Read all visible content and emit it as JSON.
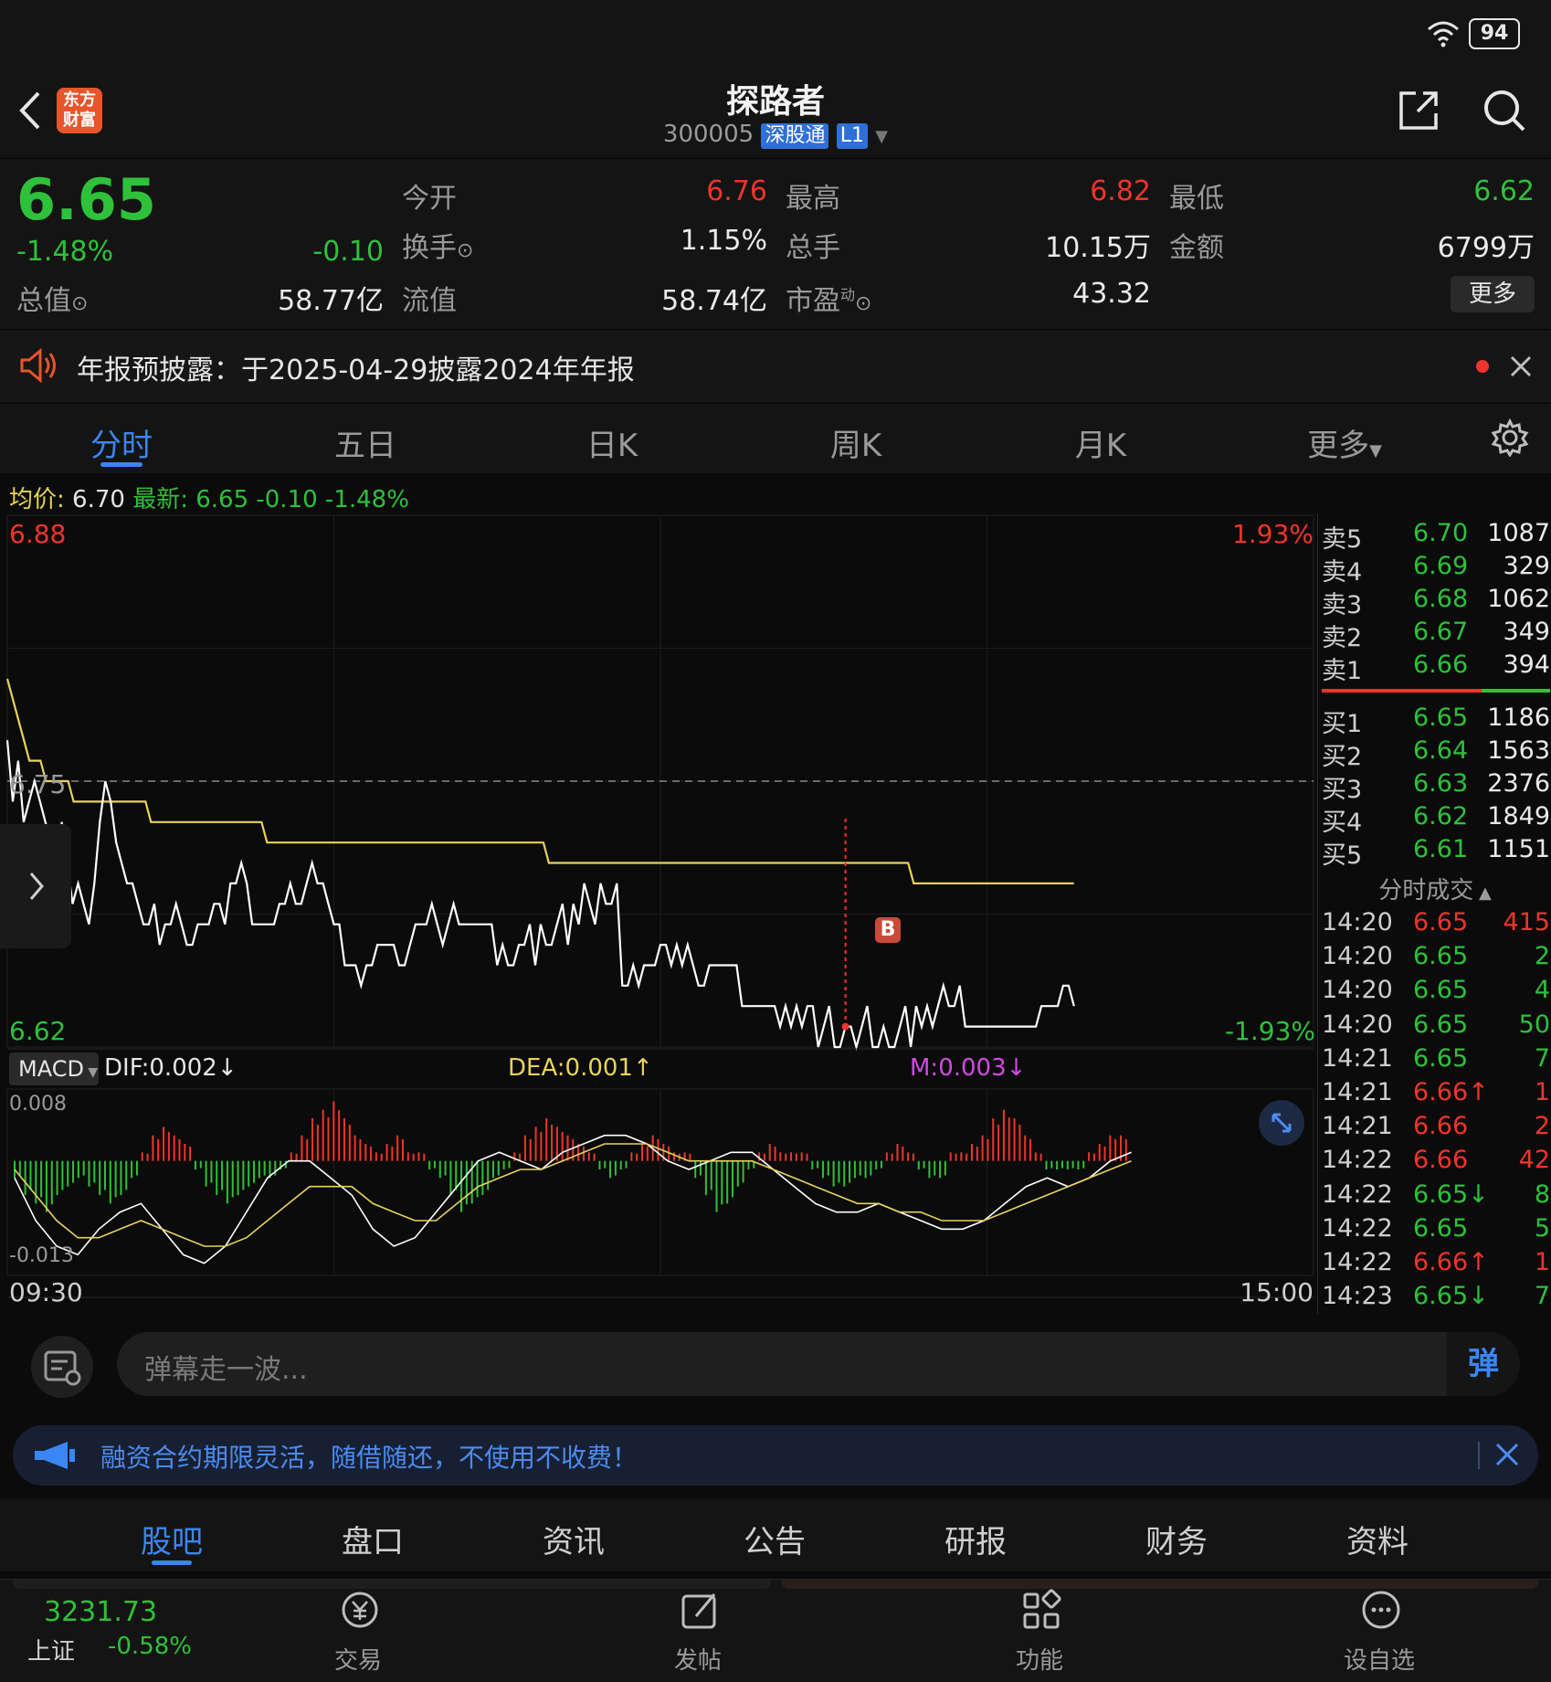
{
  "status": {
    "battery": "94"
  },
  "header": {
    "app_logo_text": "东方财富",
    "title": "探路者",
    "code": "300005",
    "tag1": "深股通",
    "tag2": "L1"
  },
  "quote": {
    "price": "6.65",
    "change_pct": "-1.48%",
    "change": "-0.10",
    "total_value_label": "总值",
    "total_value": "58.77亿",
    "open_label": "今开",
    "open": "6.76",
    "high_label": "最高",
    "high": "6.82",
    "low_label": "最低",
    "low": "6.62",
    "turnover_label": "换手",
    "turnover": "1.15%",
    "volume_label": "总手",
    "volume": "10.15万",
    "amount_label": "金额",
    "amount": "6799万",
    "float_label": "流值",
    "float_value": "58.74亿",
    "pe_label": "市盈",
    "pe_sup": "动",
    "pe": "43.32",
    "more_button": "更多"
  },
  "notice": {
    "text": "年报预披露：于2025-04-29披露2024年年报"
  },
  "ktabs": [
    "分时",
    "五日",
    "日K",
    "周K",
    "月K",
    "更多"
  ],
  "ktabs_active": 0,
  "chart_header": {
    "avg_label": "均价:",
    "avg": "6.70",
    "latest_label": "最新:",
    "latest": "6.65",
    "latest_change": "-0.10",
    "latest_pct": "-1.48%"
  },
  "chart_data": {
    "type": "line",
    "y_max_label": "6.88",
    "y_mid_label": "6.75",
    "y_min_label": "6.62",
    "pct_max_label": "1.93%",
    "pct_min_label": "-1.93%",
    "ylim": [
      6.62,
      6.88
    ],
    "prev_close": 6.75,
    "x_start_label": "09:30",
    "x_end_label": "15:00",
    "session_minutes": 240,
    "series": [
      {
        "values": [
          6.77,
          6.74,
          6.76,
          6.73,
          6.74,
          6.75,
          6.74,
          6.73,
          6.72,
          6.71,
          6.73,
          6.71,
          6.69,
          6.7,
          6.69,
          6.68,
          6.7,
          6.73,
          6.75,
          6.74,
          6.72,
          6.71,
          6.7,
          6.7,
          6.69,
          6.68,
          6.68,
          6.69,
          6.67,
          6.68,
          6.68,
          6.69,
          6.68,
          6.67,
          6.67,
          6.68,
          6.68,
          6.68,
          6.69,
          6.69,
          6.68,
          6.7,
          6.7,
          6.71,
          6.7,
          6.68,
          6.68,
          6.68,
          6.68,
          6.68,
          6.69,
          6.69,
          6.7,
          6.69,
          6.69,
          6.7,
          6.71,
          6.7,
          6.7,
          6.69,
          6.68,
          6.68,
          6.66,
          6.66,
          6.66,
          6.65,
          6.66,
          6.66,
          6.67,
          6.67,
          6.67,
          6.67,
          6.66,
          6.66,
          6.67,
          6.68,
          6.68,
          6.68,
          6.69,
          6.68,
          6.67,
          6.68,
          6.69,
          6.68,
          6.68,
          6.68,
          6.68,
          6.68,
          6.68,
          6.68,
          6.66,
          6.67,
          6.66,
          6.66,
          6.67,
          6.67,
          6.68,
          6.66,
          6.68,
          6.67,
          6.67,
          6.68,
          6.69,
          6.67,
          6.69,
          6.68,
          6.7,
          6.69,
          6.68,
          6.7,
          6.69,
          6.69,
          6.7,
          6.65,
          6.65,
          6.66,
          6.65,
          6.66,
          6.66,
          6.66,
          6.67,
          6.67,
          6.66,
          6.67,
          6.66,
          6.67,
          6.66,
          6.65,
          6.65,
          6.66,
          6.66,
          6.66,
          6.66,
          6.66,
          6.66,
          6.64,
          6.64,
          6.64,
          6.64,
          6.64,
          6.64,
          6.64,
          6.63,
          6.64,
          6.63,
          6.64,
          6.63,
          6.64,
          6.64,
          6.62,
          6.63,
          6.64,
          6.62,
          6.62,
          6.63,
          6.63,
          6.62,
          6.63,
          6.64,
          6.62,
          6.62,
          6.63,
          6.62,
          6.62,
          6.63,
          6.64,
          6.62,
          6.64,
          6.63,
          6.64,
          6.63,
          6.64,
          6.65,
          6.64,
          6.64,
          6.65,
          6.63,
          6.63,
          6.63,
          6.63,
          6.63,
          6.63,
          6.63,
          6.63,
          6.63,
          6.63,
          6.63,
          6.63,
          6.63,
          6.63,
          6.64,
          6.64,
          6.64,
          6.64,
          6.65,
          6.65,
          6.64
        ]
      },
      {
        "values": [
          6.8,
          6.79,
          6.78,
          6.77,
          6.76,
          6.76,
          6.76,
          6.75,
          6.75,
          6.75,
          6.75,
          6.75,
          6.74,
          6.74,
          6.74,
          6.74,
          6.74,
          6.74,
          6.74,
          6.74,
          6.74,
          6.74,
          6.74,
          6.74,
          6.74,
          6.74,
          6.73,
          6.73,
          6.73,
          6.73,
          6.73,
          6.73,
          6.73,
          6.73,
          6.73,
          6.73,
          6.73,
          6.73,
          6.73,
          6.73,
          6.73,
          6.73,
          6.73,
          6.73,
          6.73,
          6.73,
          6.73,
          6.72,
          6.72,
          6.72,
          6.72,
          6.72,
          6.72,
          6.72,
          6.72,
          6.72,
          6.72,
          6.72,
          6.72,
          6.72,
          6.72,
          6.72,
          6.72,
          6.72,
          6.72,
          6.72,
          6.72,
          6.72,
          6.72,
          6.72,
          6.72,
          6.72,
          6.72,
          6.72,
          6.72,
          6.72,
          6.72,
          6.72,
          6.72,
          6.72,
          6.72,
          6.72,
          6.72,
          6.72,
          6.72,
          6.72,
          6.72,
          6.72,
          6.72,
          6.72,
          6.72,
          6.72,
          6.72,
          6.72,
          6.72,
          6.72,
          6.72,
          6.72,
          6.71,
          6.71,
          6.71,
          6.71,
          6.71,
          6.71,
          6.71,
          6.71,
          6.71,
          6.71,
          6.71,
          6.71,
          6.71,
          6.71,
          6.71,
          6.71,
          6.71,
          6.71,
          6.71,
          6.71,
          6.71,
          6.71,
          6.71,
          6.71,
          6.71,
          6.71,
          6.71,
          6.71,
          6.71,
          6.71,
          6.71,
          6.71,
          6.71,
          6.71,
          6.71,
          6.71,
          6.71,
          6.71,
          6.71,
          6.71,
          6.71,
          6.71,
          6.71,
          6.71,
          6.71,
          6.71,
          6.71,
          6.71,
          6.71,
          6.71,
          6.71,
          6.71,
          6.71,
          6.71,
          6.71,
          6.71,
          6.71,
          6.71,
          6.71,
          6.71,
          6.71,
          6.71,
          6.71,
          6.71,
          6.71,
          6.71,
          6.7,
          6.7,
          6.7,
          6.7,
          6.7,
          6.7,
          6.7,
          6.7,
          6.7,
          6.7,
          6.7,
          6.7,
          6.7,
          6.7,
          6.7,
          6.7,
          6.7,
          6.7,
          6.7,
          6.7,
          6.7,
          6.7,
          6.7,
          6.7,
          6.7,
          6.7,
          6.7,
          6.7,
          6.7,
          6.7
        ]
      }
    ],
    "macd": {
      "label": "MACD",
      "dif": "DIF:0.002",
      "dea": "DEA:0.001",
      "m": "M:0.003",
      "top_label": "0.008",
      "bottom_label": "-0.013",
      "ylim": [
        -0.013,
        0.008
      ],
      "hist": [
        -0.002,
        -0.004,
        -0.005,
        -0.006,
        -0.004,
        -0.003,
        -0.002,
        -0.003,
        -0.004,
        -0.005,
        -0.004,
        -0.002,
        0.001,
        0.003,
        0.004,
        0.003,
        0.002,
        -0.001,
        -0.003,
        -0.004,
        -0.005,
        -0.004,
        -0.003,
        -0.002,
        -0.002,
        -0.001,
        0.001,
        0.003,
        0.005,
        0.006,
        0.007,
        0.005,
        0.003,
        0.002,
        0.001,
        0.002,
        0.003,
        0.001,
        0.001,
        -0.001,
        -0.002,
        -0.004,
        -0.006,
        -0.005,
        -0.004,
        -0.002,
        -0.001,
        0.001,
        0.003,
        0.004,
        0.005,
        0.004,
        0.003,
        0.002,
        0.001,
        -0.001,
        -0.002,
        -0.001,
        0.001,
        0.002,
        0.003,
        0.002,
        0.001,
        0.001,
        -0.002,
        -0.004,
        -0.006,
        -0.005,
        -0.003,
        -0.001,
        0.001,
        0.002,
        0.001,
        0.001,
        0.001,
        -0.001,
        -0.002,
        -0.003,
        -0.003,
        -0.002,
        -0.002,
        -0.001,
        0.001,
        0.002,
        0.001,
        -0.001,
        -0.002,
        -0.002,
        0.001,
        0.001,
        0.002,
        0.003,
        0.005,
        0.006,
        0.005,
        0.003,
        0.001,
        -0.001,
        -0.001,
        -0.001,
        -0.001,
        0.001,
        0.002,
        0.003,
        0.003
      ],
      "dif_line": [
        -0.002,
        -0.007,
        -0.01,
        -0.011,
        -0.008,
        -0.006,
        -0.005,
        -0.008,
        -0.011,
        -0.012,
        -0.01,
        -0.006,
        -0.002,
        0.0,
        0.0,
        -0.002,
        -0.004,
        -0.008,
        -0.01,
        -0.009,
        -0.006,
        -0.003,
        0.0,
        0.001,
        0.0,
        -0.001,
        0.001,
        0.002,
        0.003,
        0.003,
        0.002,
        0.0,
        -0.001,
        0.0,
        0.001,
        0.001,
        -0.001,
        -0.003,
        -0.005,
        -0.006,
        -0.006,
        -0.005,
        -0.006,
        -0.007,
        -0.008,
        -0.008,
        -0.007,
        -0.005,
        -0.003,
        -0.002,
        -0.003,
        -0.002,
        0.0,
        0.001
      ],
      "dea_line": [
        -0.001,
        -0.004,
        -0.007,
        -0.009,
        -0.009,
        -0.008,
        -0.007,
        -0.008,
        -0.009,
        -0.01,
        -0.01,
        -0.009,
        -0.007,
        -0.005,
        -0.003,
        -0.003,
        -0.003,
        -0.005,
        -0.006,
        -0.007,
        -0.007,
        -0.005,
        -0.003,
        -0.002,
        -0.001,
        -0.001,
        0.0,
        0.001,
        0.002,
        0.002,
        0.002,
        0.001,
        0.0,
        0.0,
        0.0,
        0.0,
        -0.001,
        -0.002,
        -0.003,
        -0.004,
        -0.005,
        -0.005,
        -0.006,
        -0.006,
        -0.007,
        -0.007,
        -0.007,
        -0.006,
        -0.005,
        -0.004,
        -0.003,
        -0.002,
        -0.001,
        0.0
      ]
    },
    "buy_marker": "B"
  },
  "orderbook": {
    "asks": [
      {
        "label": "卖5",
        "price": "6.70",
        "vol": "1087"
      },
      {
        "label": "卖4",
        "price": "6.69",
        "vol": "329"
      },
      {
        "label": "卖3",
        "price": "6.68",
        "vol": "1062"
      },
      {
        "label": "卖2",
        "price": "6.67",
        "vol": "349"
      },
      {
        "label": "卖1",
        "price": "6.66",
        "vol": "394"
      }
    ],
    "bids": [
      {
        "label": "买1",
        "price": "6.65",
        "vol": "1186"
      },
      {
        "label": "买2",
        "price": "6.64",
        "vol": "1563"
      },
      {
        "label": "买3",
        "price": "6.63",
        "vol": "2376"
      },
      {
        "label": "买4",
        "price": "6.62",
        "vol": "1849"
      },
      {
        "label": "买5",
        "price": "6.61",
        "vol": "1151"
      }
    ],
    "ticks_title": "分时成交",
    "ticks": [
      {
        "time": "14:20",
        "price": "6.65",
        "arrow": "",
        "vol": "415",
        "color": "red"
      },
      {
        "time": "14:20",
        "price": "6.65",
        "arrow": "",
        "vol": "2",
        "color": "green"
      },
      {
        "time": "14:20",
        "price": "6.65",
        "arrow": "",
        "vol": "4",
        "color": "green"
      },
      {
        "time": "14:20",
        "price": "6.65",
        "arrow": "",
        "vol": "50",
        "color": "green"
      },
      {
        "time": "14:21",
        "price": "6.65",
        "arrow": "",
        "vol": "7",
        "color": "green"
      },
      {
        "time": "14:21",
        "price": "6.66",
        "arrow": "↑",
        "vol": "1",
        "color": "red"
      },
      {
        "time": "14:21",
        "price": "6.66",
        "arrow": "",
        "vol": "2",
        "color": "red"
      },
      {
        "time": "14:22",
        "price": "6.66",
        "arrow": "",
        "vol": "42",
        "color": "red"
      },
      {
        "time": "14:22",
        "price": "6.65",
        "arrow": "↓",
        "vol": "8",
        "color": "green"
      },
      {
        "time": "14:22",
        "price": "6.65",
        "arrow": "",
        "vol": "5",
        "color": "green"
      },
      {
        "time": "14:22",
        "price": "6.66",
        "arrow": "↑",
        "vol": "1",
        "color": "red"
      },
      {
        "time": "14:23",
        "price": "6.65",
        "arrow": "↓",
        "vol": "7",
        "color": "green"
      }
    ]
  },
  "danmu": {
    "placeholder": "弹幕走一波...",
    "send_icon_text": "弹"
  },
  "promo": {
    "text": "融资合约期限灵活，随借随还，不使用不收费！"
  },
  "bottom_tabs": [
    "股吧",
    "盘口",
    "资讯",
    "公告",
    "研报",
    "财务",
    "资料"
  ],
  "bottom_tabs_active": 0,
  "index": {
    "value": "3231.73",
    "name": "上证",
    "pct": "-0.58%"
  },
  "nav": [
    {
      "label": "交易",
      "icon": "yuan-icon"
    },
    {
      "label": "发帖",
      "icon": "edit-icon"
    },
    {
      "label": "功能",
      "icon": "grid-icon"
    },
    {
      "label": "设自选",
      "icon": "more-icon"
    }
  ],
  "colors": {
    "up": "#f0342c",
    "down": "#2ec13a",
    "avg_line": "#e8d35a",
    "price_line": "#ffffff",
    "accent": "#3b86f5"
  }
}
